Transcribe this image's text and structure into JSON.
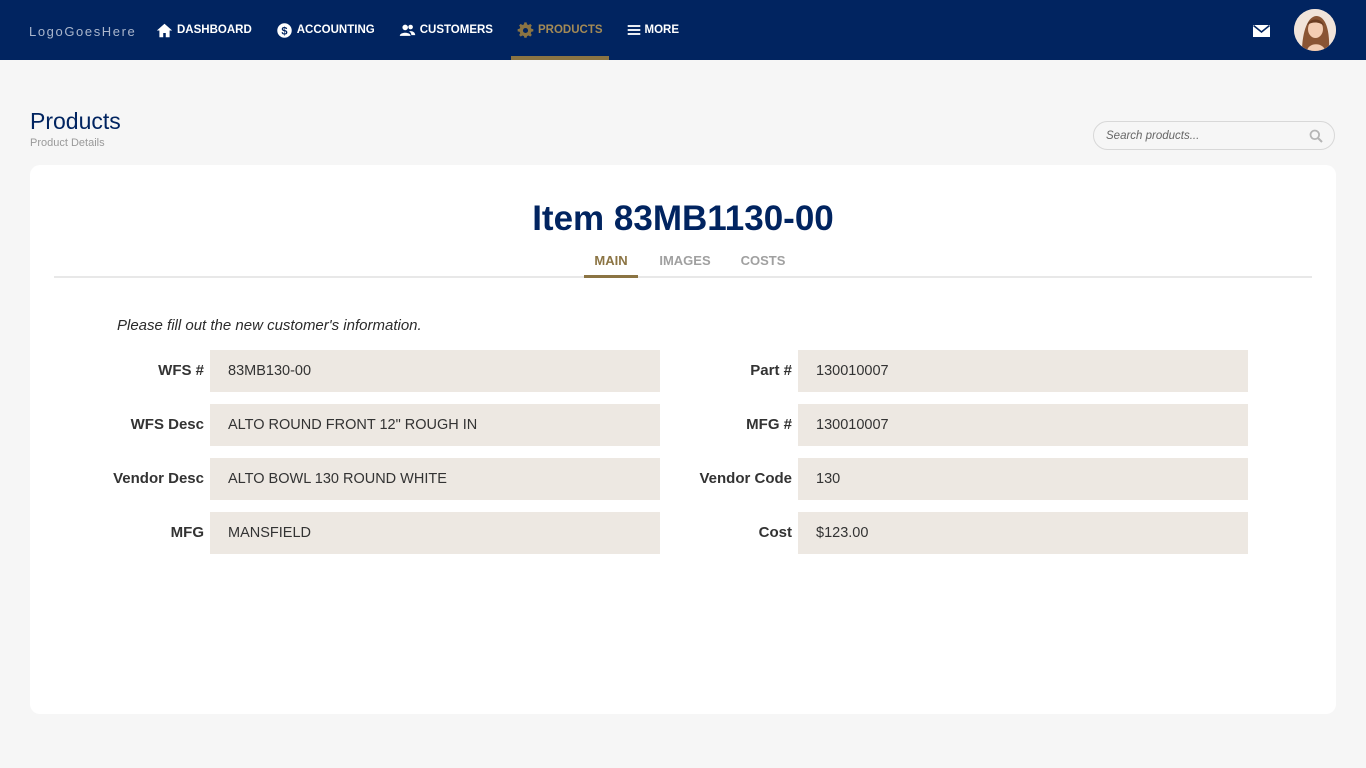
{
  "header": {
    "logo": "LogoGoesHere",
    "nav": [
      {
        "label": "DASHBOARD",
        "icon": "home-icon"
      },
      {
        "label": "ACCOUNTING",
        "icon": "dollar-icon"
      },
      {
        "label": "CUSTOMERS",
        "icon": "users-icon"
      },
      {
        "label": "PRODUCTS",
        "icon": "gear-icon",
        "active": true
      },
      {
        "label": "MORE",
        "icon": "menu-icon"
      }
    ],
    "mail_icon": "mail-icon",
    "avatar_icon": "user-avatar"
  },
  "page": {
    "title": "Products",
    "subtitle": "Product Details",
    "search_placeholder": "Search products..."
  },
  "card": {
    "item_title": "Item 83MB1130-00",
    "tabs": [
      {
        "label": "MAIN",
        "active": true
      },
      {
        "label": "IMAGES"
      },
      {
        "label": "COSTS"
      }
    ],
    "instructions": "Please fill out the new customer's information.",
    "left_fields": [
      {
        "label": "WFS #",
        "value": "83MB130-00"
      },
      {
        "label": "WFS Desc",
        "value": "ALTO ROUND FRONT 12\" ROUGH IN"
      },
      {
        "label": "Vendor Desc",
        "value": "ALTO BOWL 130 ROUND WHITE"
      },
      {
        "label": "MFG",
        "value": "MANSFIELD"
      }
    ],
    "right_fields": [
      {
        "label": "Part #",
        "value": "130010007"
      },
      {
        "label": "MFG #",
        "value": "130010007"
      },
      {
        "label": "Vendor Code",
        "value": "130"
      },
      {
        "label": "Cost",
        "value": "$123.00"
      }
    ]
  },
  "colors": {
    "navy": "#012460",
    "gold": "#8b7443",
    "field_bg": "#ede8e2",
    "page_bg": "#f6f6f6"
  }
}
